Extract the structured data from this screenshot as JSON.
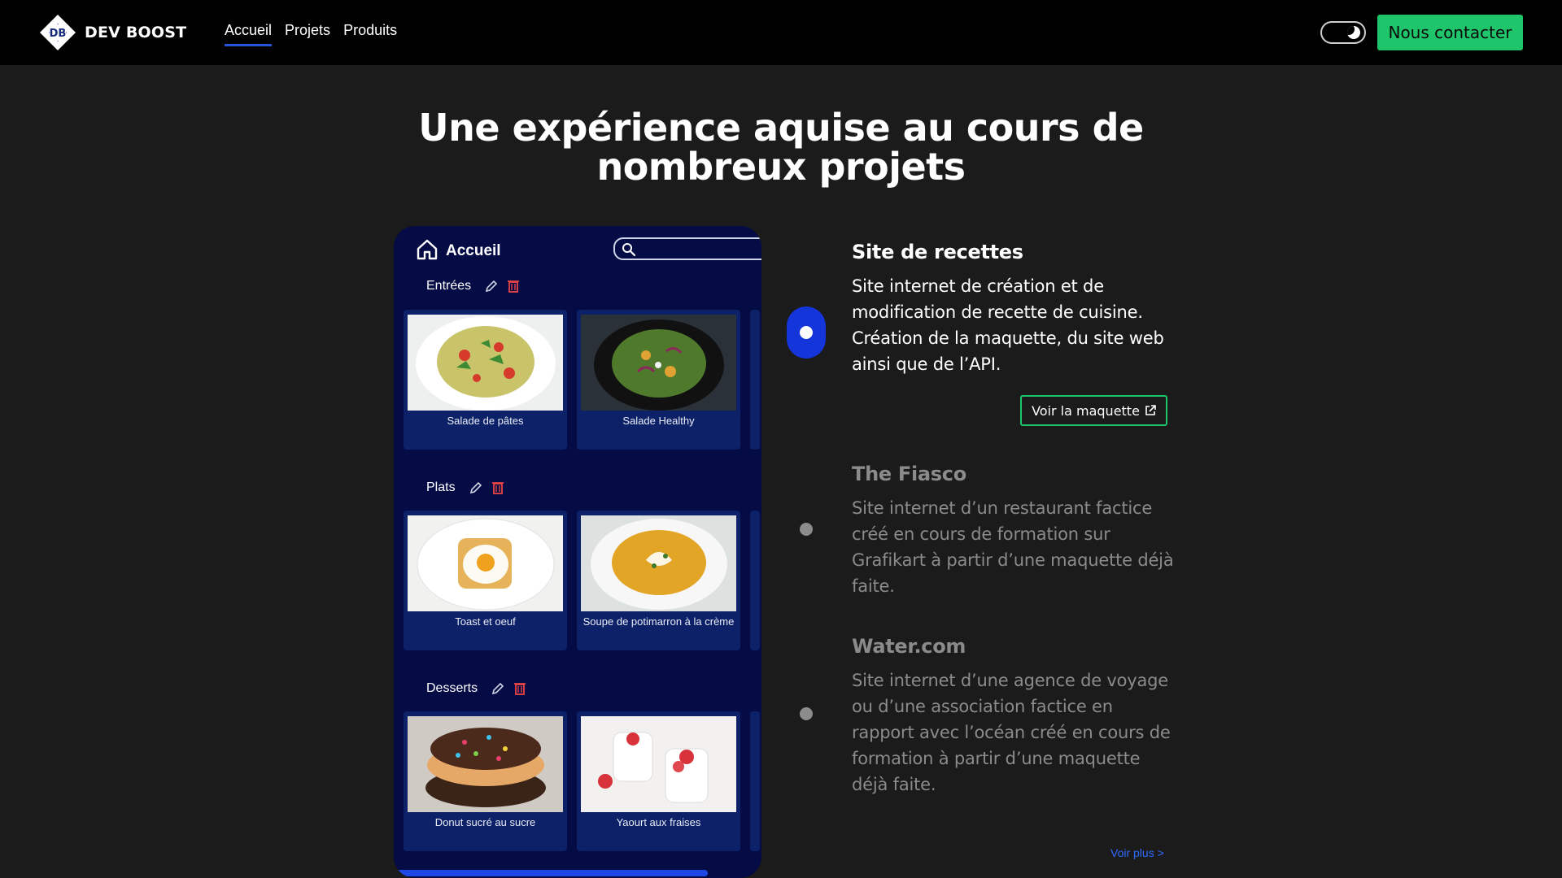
{
  "header": {
    "brand": "DEV BOOST",
    "nav": [
      {
        "label": "Accueil",
        "active": true
      },
      {
        "label": "Projets",
        "active": false
      },
      {
        "label": "Produits",
        "active": false
      }
    ],
    "contact_label": "Nous contacter",
    "accent_color": "#1fc56a",
    "active_color": "#2454d9"
  },
  "main": {
    "headline_line1": "Une expérience aquise au cours de",
    "headline_line2": "nombreux projets"
  },
  "mockup": {
    "title": "Accueil",
    "categories": [
      {
        "name": "Entrées",
        "items": [
          "Salade de pâtes",
          "Salade Healthy"
        ]
      },
      {
        "name": "Plats",
        "items": [
          "Toast et oeuf",
          "Soupe de potimarron à la crème"
        ]
      },
      {
        "name": "Desserts",
        "items": [
          "Donut sucré au sucre",
          "Yaourt aux fraises"
        ]
      }
    ]
  },
  "projects": [
    {
      "title": "Site de recettes",
      "description": "Site internet de création et de modification de recette de cuisine. Création de la maquette, du site web ainsi que de l’API.",
      "active": true,
      "link_label": "Voir la maquette"
    },
    {
      "title": "The Fiasco",
      "description": "Site internet d’un restaurant factice créé en cours de formation sur Grafikart à partir d’une maquette déjà faite.",
      "active": false
    },
    {
      "title": "Water.com",
      "description": "Site internet d’une agence de voyage ou d’une association factice en rapport avec l’océan créé en cours de formation à partir d’une maquette déjà faite.",
      "active": false
    }
  ],
  "more_label": "Voir plus >"
}
